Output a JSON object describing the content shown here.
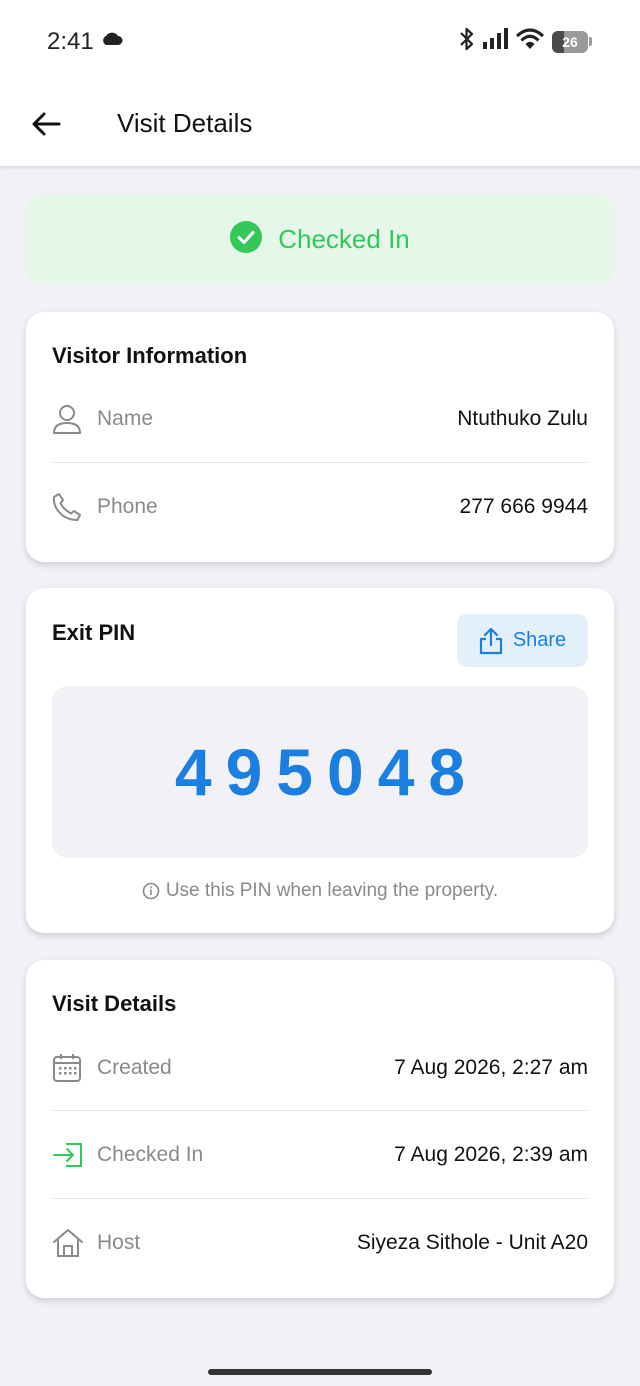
{
  "statusbar": {
    "time": "2:41",
    "battery": "26"
  },
  "appbar": {
    "title": "Visit Details"
  },
  "status_banner": {
    "label": "Checked In",
    "color": "#34c759"
  },
  "visitor_info": {
    "title": "Visitor Information",
    "rows": [
      {
        "label": "Name",
        "value": "Ntuthuko Zulu",
        "icon": "person-icon"
      },
      {
        "label": "Phone",
        "value": "277 666 9944",
        "icon": "phone-icon"
      }
    ]
  },
  "exit_pin": {
    "title": "Exit PIN",
    "share_label": "Share",
    "pin": "495048",
    "hint": "Use this PIN when leaving the property.",
    "accent": "#1a7fe0"
  },
  "visit_details": {
    "title": "Visit Details",
    "rows": [
      {
        "label": "Created",
        "value": "7 Aug 2026, 2:27 am",
        "icon": "calendar-icon"
      },
      {
        "label": "Checked In",
        "value": "7 Aug 2026, 2:39 am",
        "icon": "login-icon"
      },
      {
        "label": "Host",
        "value": "Siyeza Sithole - Unit A20",
        "icon": "home-icon"
      }
    ]
  }
}
